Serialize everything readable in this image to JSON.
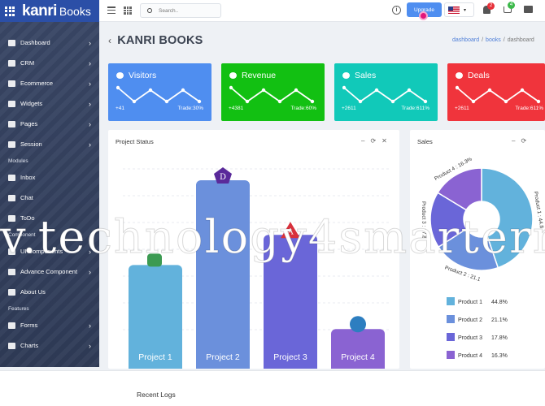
{
  "brand": {
    "name": "kanri",
    "sub": "Books"
  },
  "topbar": {
    "search_placeholder": "Search..",
    "upgrade_label": "Upgrade",
    "notifications_count": "2",
    "cart_count": "4",
    "info_glyph": "i",
    "dropdown_glyph": "▾"
  },
  "sidebar": {
    "items": [
      {
        "label": "Dashboard",
        "arrow": "›"
      },
      {
        "label": "CRM",
        "arrow": "›"
      },
      {
        "label": "Ecommerce",
        "arrow": "›"
      },
      {
        "label": "Widgets",
        "arrow": "›"
      },
      {
        "label": "Pages",
        "arrow": "›"
      },
      {
        "label": "Session",
        "arrow": "›"
      }
    ],
    "section_modules": "Modules",
    "modules": [
      {
        "label": "Inbox"
      },
      {
        "label": "Chat"
      },
      {
        "label": "ToDo"
      }
    ],
    "section_component": "Component",
    "components": [
      {
        "label": "UI Components",
        "arrow": "›"
      },
      {
        "label": "Advance Component",
        "arrow": "›"
      },
      {
        "label": "About Us"
      }
    ],
    "section_features": "Features",
    "features": [
      {
        "label": "Forms",
        "arrow": "›"
      },
      {
        "label": "Charts",
        "arrow": "›"
      }
    ]
  },
  "page": {
    "back_glyph": "‹",
    "title": "KANRI BOOKS",
    "breadcrumb": [
      "dashboard",
      "books",
      "dashboard"
    ],
    "breadcrumb_sep": "/"
  },
  "stats": [
    {
      "title": "Visitors",
      "value": "+41",
      "trade": "Trade:30%",
      "color": "#4f8ef0"
    },
    {
      "title": "Revenue",
      "value": "+4381",
      "trade": "Trade:60%",
      "color": "#12c012"
    },
    {
      "title": "Sales",
      "value": "+2611",
      "trade": "Trade:611%",
      "color": "#11c9b9"
    },
    {
      "title": "Deals",
      "value": "+2611",
      "trade": "Trade:611%",
      "color": "#f0343c"
    }
  ],
  "panels": {
    "project_status": {
      "title": "Project Status",
      "tools": [
        "–",
        "⟳",
        "✕"
      ]
    },
    "sales": {
      "title": "Sales",
      "tools": [
        "–",
        "⟳"
      ]
    },
    "recent_logs": {
      "title": "Recent Logs"
    }
  },
  "chart_data": [
    {
      "type": "bar",
      "categories": [
        "Project 1",
        "Project 2",
        "Project 3",
        "Project 4"
      ],
      "values": [
        55,
        100,
        71,
        21
      ],
      "markers": [
        "",
        "D",
        "A",
        ""
      ],
      "colors": [
        "#62b2dc",
        "#6b90dc",
        "#6a66d8",
        "#8a63d2"
      ],
      "ylim": [
        0,
        100
      ]
    },
    {
      "type": "pie",
      "categories": [
        "Product 1",
        "Product 2",
        "Product 3",
        "Product 4"
      ],
      "values": [
        44.8,
        21.1,
        17.8,
        16.3
      ],
      "labels": [
        "Product 1 : 44.8",
        "Product 2 : 21.1",
        "Product 3 : 17.8",
        "Product 4 : 16.3%"
      ],
      "legend_values": [
        "44.8%",
        "21.1%",
        "17.8%",
        "16.3%"
      ],
      "colors": [
        "#62b2dc",
        "#6b90dc",
        "#6a66d8",
        "#8a63d2"
      ]
    }
  ],
  "watermark": "v.technology4smartern"
}
